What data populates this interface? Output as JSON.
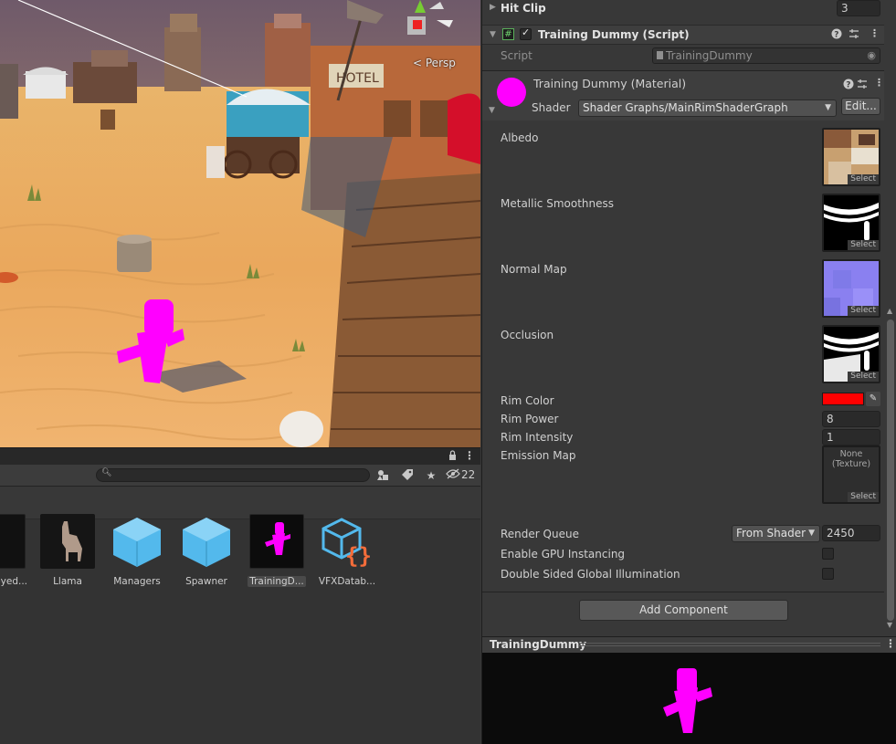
{
  "scene": {
    "view_label": "Persp",
    "sign_text": "HOTEL"
  },
  "project": {
    "hidden_count": "22",
    "search": {
      "placeholder": ""
    },
    "icons": [
      "lock-icon",
      "more-icon",
      "search-icon",
      "filter-by-type-icon",
      "label-icon",
      "favorite-icon",
      "visibility-icon"
    ],
    "assets": [
      {
        "name": "oyed...",
        "kind": "prefab"
      },
      {
        "name": "Llama",
        "kind": "prefab"
      },
      {
        "name": "Managers",
        "kind": "prefab"
      },
      {
        "name": "Spawner",
        "kind": "prefab"
      },
      {
        "name": "TrainingD...",
        "kind": "prefab",
        "selected": true
      },
      {
        "name": "VFXDatab...",
        "kind": "script"
      }
    ]
  },
  "inspector": {
    "hit_clip": {
      "label": "Hit Clip",
      "value": "3"
    },
    "script_component": {
      "title": "Training Dummy (Script)",
      "enabled": true,
      "script_label": "Script",
      "script_value": "TrainingDummy"
    },
    "material": {
      "title": "Training Dummy (Material)",
      "shader_label": "Shader",
      "shader_value": "Shader Graphs/MainRimShaderGraph",
      "edit_button": "Edit...",
      "swatch_color": "#ff00ff"
    },
    "properties": {
      "albedo": "Albedo",
      "metallic": "Metallic Smoothness",
      "normal": "Normal Map",
      "occlusion": "Occlusion",
      "select": "Select",
      "rim_color_label": "Rim Color",
      "rim_color": "#ff0000",
      "rim_power_label": "Rim Power",
      "rim_power": "8",
      "rim_intensity_label": "Rim Intensity",
      "rim_intensity": "1",
      "emission_label": "Emission Map",
      "emission_value_line1": "None",
      "emission_value_line2": "(Texture)",
      "render_queue_label": "Render Queue",
      "render_queue_mode": "From Shader",
      "render_queue_value": "2450",
      "gpu_instancing_label": "Enable GPU Instancing",
      "gpu_instancing": false,
      "double_sided_gi_label": "Double Sided Global Illumination",
      "double_sided_gi": false
    },
    "add_component": "Add Component"
  },
  "preview": {
    "title": "TrainingDummy",
    "accent": "#ff00ff"
  }
}
